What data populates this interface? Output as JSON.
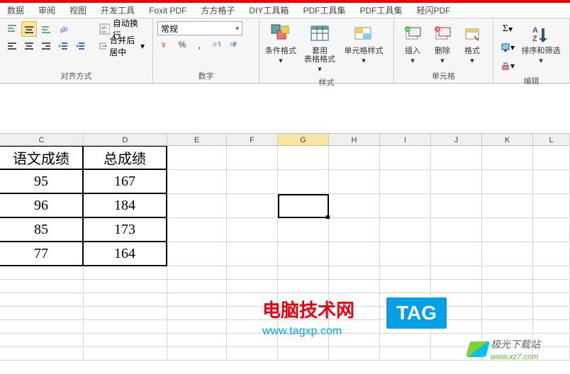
{
  "tabs": [
    "数据",
    "审阅",
    "视图",
    "开发工具",
    "Foxit PDF",
    "方方格子",
    "DIY工具箱",
    "PDF工具集",
    "PDF工具集",
    "轻闪PDF"
  ],
  "ribbon": {
    "align": {
      "wrap": "自动换行",
      "merge": "合并后居中",
      "label": "对齐方式"
    },
    "number": {
      "format": "常规",
      "percent": "%",
      "comma": ",",
      "inc_dec_labels": [
        ".0",
        ".00"
      ],
      "label": "数字"
    },
    "styles": {
      "cond": "条件格式",
      "table": "套用\n表格格式",
      "cell": "单元格样式",
      "label": "样式"
    },
    "cells": {
      "insert": "插入",
      "delete": "删除",
      "format": "格式",
      "label": "单元格"
    },
    "edit": {
      "sort": "排序和筛选",
      "label": "编辑"
    }
  },
  "columns": [
    "C",
    "D",
    "E",
    "F",
    "G",
    "H",
    "I",
    "J",
    "K",
    "L"
  ],
  "selected_col": "G",
  "table": {
    "headers": [
      "语文成绩",
      "总成绩"
    ],
    "rows": [
      [
        "95",
        "167"
      ],
      [
        "96",
        "184"
      ],
      [
        "85",
        "173"
      ],
      [
        "77",
        "164"
      ]
    ]
  },
  "watermark": {
    "title": "电脑技术网",
    "url": "www.tagxp.com",
    "tag": "TAG",
    "jg_name": "极光下载站",
    "jg_url": "www.xz7.com"
  }
}
